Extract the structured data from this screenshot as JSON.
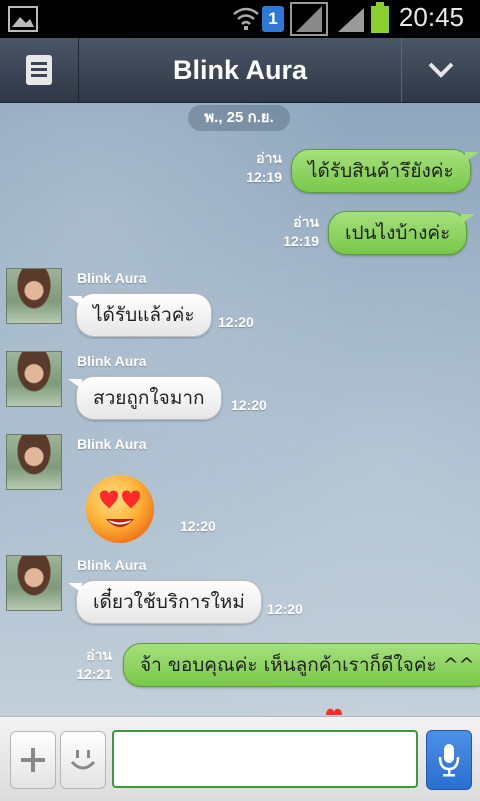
{
  "status_bar": {
    "time": "20:45",
    "sim_slot": "1",
    "icons": [
      "image-icon",
      "wifi-icon",
      "sim-icon",
      "signal-icon",
      "signal-icon",
      "battery-icon"
    ]
  },
  "header": {
    "title": "Blink Aura",
    "menu_icon": "list-icon",
    "dropdown_icon": "chevron-down-icon"
  },
  "chat": {
    "date": "พ., 25 ก.ย.",
    "messages": [
      {
        "dir": "out",
        "text": "ได้รับสินค้ารึยังค่ะ",
        "read": "อ่าน",
        "time": "12:19"
      },
      {
        "dir": "out",
        "text": "เปนไงบ้างค่ะ",
        "read": "อ่าน",
        "time": "12:19"
      },
      {
        "dir": "in",
        "sender": "Blink Aura",
        "text": "ได้รับแล้วค่ะ",
        "time": "12:20"
      },
      {
        "dir": "in",
        "sender": "Blink Aura",
        "text": "สวยถูกใจมาก",
        "time": "12:20"
      },
      {
        "dir": "in",
        "sender": "Blink Aura",
        "sticker": "heart-eyes-emoji",
        "time": "12:20"
      },
      {
        "dir": "in",
        "sender": "Blink Aura",
        "text": "เดี๋ยวใช้บริการใหม่",
        "time": "12:20"
      },
      {
        "dir": "out",
        "text": "จ้า ขอบคุณค่ะ เห็นลูกค้าเราก็ดีใจค่ะ ^^",
        "read": "อ่าน",
        "time": "12:21"
      }
    ]
  },
  "input_bar": {
    "value": "",
    "add_icon": "plus-icon",
    "sticker_icon": "smiley-icon",
    "mic_icon": "microphone-icon"
  },
  "colors": {
    "header": "#3a4454",
    "outgoing_bubble": "#8fd363",
    "incoming_bubble": "#ffffff",
    "mic_button": "#3a7fdc",
    "input_border": "#3c9a3c"
  }
}
